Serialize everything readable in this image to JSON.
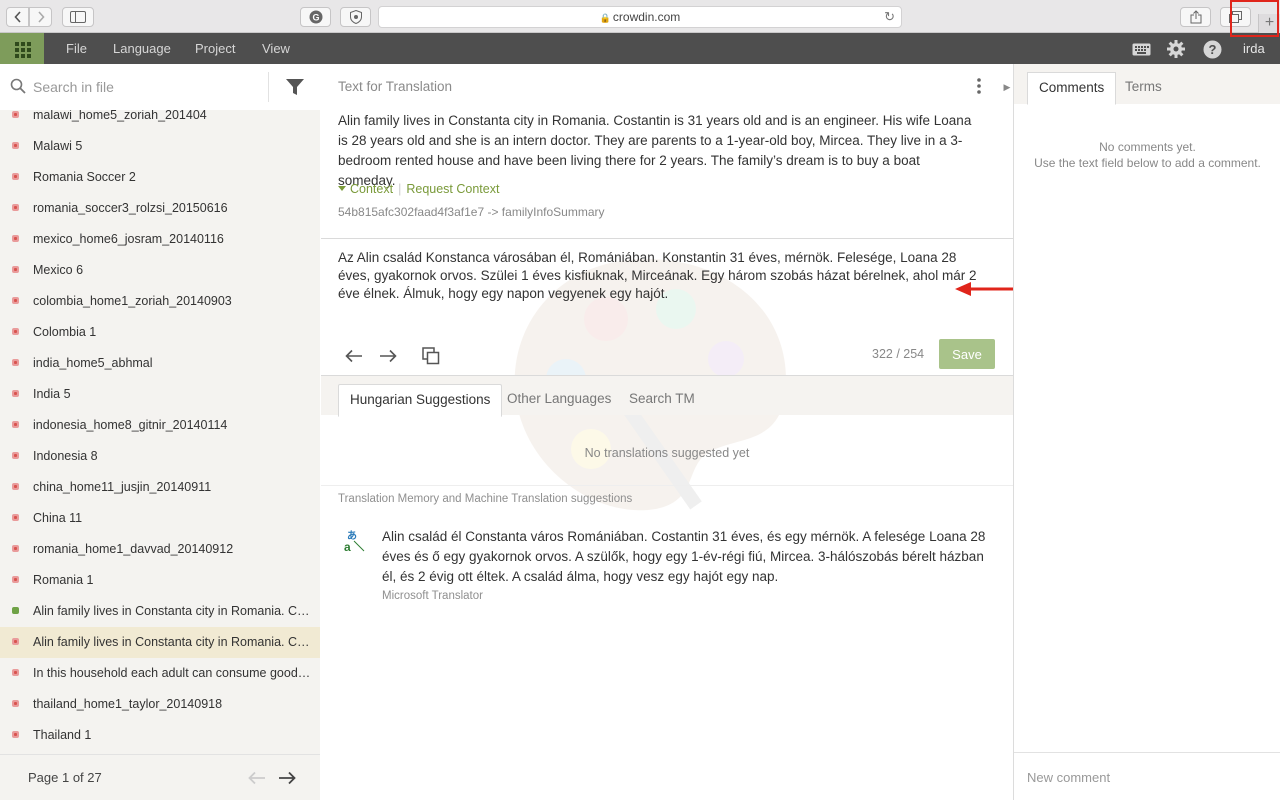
{
  "browser": {
    "url": "crowdin.com"
  },
  "nav": {
    "menu": [
      "File",
      "Language",
      "Project",
      "View"
    ],
    "user": "irda"
  },
  "search": {
    "placeholder": "Search in file"
  },
  "files": [
    {
      "label": "malawi_home5_zoriah_201404",
      "status": "untranslated"
    },
    {
      "label": "Malawi 5",
      "status": "untranslated"
    },
    {
      "label": "Romania Soccer 2",
      "status": "untranslated"
    },
    {
      "label": "romania_soccer3_rolzsi_20150616",
      "status": "untranslated"
    },
    {
      "label": "mexico_home6_josram_20140116",
      "status": "untranslated"
    },
    {
      "label": "Mexico 6",
      "status": "untranslated"
    },
    {
      "label": "colombia_home1_zoriah_20140903",
      "status": "untranslated"
    },
    {
      "label": "Colombia 1",
      "status": "untranslated"
    },
    {
      "label": "india_home5_abhmal",
      "status": "untranslated"
    },
    {
      "label": "India 5",
      "status": "untranslated"
    },
    {
      "label": "indonesia_home8_gitnir_20140114",
      "status": "untranslated"
    },
    {
      "label": "Indonesia 8",
      "status": "untranslated"
    },
    {
      "label": "china_home11_jusjin_20140911",
      "status": "untranslated"
    },
    {
      "label": "China 11",
      "status": "untranslated"
    },
    {
      "label": "romania_home1_davvad_20140912",
      "status": "untranslated"
    },
    {
      "label": "Romania 1",
      "status": "untranslated"
    },
    {
      "label": "Alin family lives in Constanta city in Romania. Cos...",
      "status": "translated"
    },
    {
      "label": "Alin family lives in Constanta city in Romania. Cos...",
      "status": "untranslated",
      "active": true
    },
    {
      "label": "In this household each adult can consume goods ...",
      "status": "untranslated"
    },
    {
      "label": "thailand_home1_taylor_20140918",
      "status": "untranslated"
    },
    {
      "label": "Thailand 1",
      "status": "untranslated"
    }
  ],
  "pager": {
    "text": "Page 1 of 27"
  },
  "editor": {
    "section_title": "Text for Translation",
    "source_text": "Alin family lives in Constanta city in Romania. Costantin is 31 years old and is an engineer. His wife Loana is 28 years old and she is an intern doctor. They are parents to a 1-year-old boy, Mircea. They live in a 3-bedroom rented house and have been living there for 2 years. The family’s dream is to buy a boat someday.",
    "context_label": "Context",
    "request_context_label": "Request Context",
    "string_key": "54b815afc302faad4f3af1e7 -> familyInfoSummary",
    "translation_text": "Az Alin család Konstanca városában él, Romániában. Konstantin 31 éves, mérnök. Felesége, Loana 28 éves, gyakornok orvos. Szülei 1 éves kisfiuknak, Mirceának. Egy három szobás házat bérelnek, ahol már 2 éve élnek. Álmuk, hogy egy napon vegyenek egy hajót.",
    "counter": "322 / 254",
    "save_label": "Save"
  },
  "suggestions": {
    "tabs": [
      "Hungarian Suggestions",
      "Other Languages",
      "Search TM"
    ],
    "empty": "No translations suggested yet",
    "tm_header": "Translation Memory and Machine Translation suggestions",
    "mt_text": "Alin család él Constanta város Romániában. Costantin 31 éves, és egy mérnök. A felesége Loana 28 éves és ő egy gyakornok orvos. A szülők, hogy egy 1-év-régi fiú, Mircea. 3-hálószobás bérelt házban él, és 2 évig ott éltek. A család álma, hogy vesz egy hajót egy nap.",
    "mt_source": "Microsoft Translator"
  },
  "comments": {
    "tabs": [
      "Comments",
      "Terms"
    ],
    "empty_line1": "No comments yet.",
    "empty_line2": "Use the text field below to add a comment.",
    "placeholder": "New comment"
  },
  "colors": {
    "accent_green": "#7e9c5b",
    "save_button": "#a9c38a",
    "nav_bg": "#4e4e4e",
    "annotation_red": "#e0251b"
  }
}
